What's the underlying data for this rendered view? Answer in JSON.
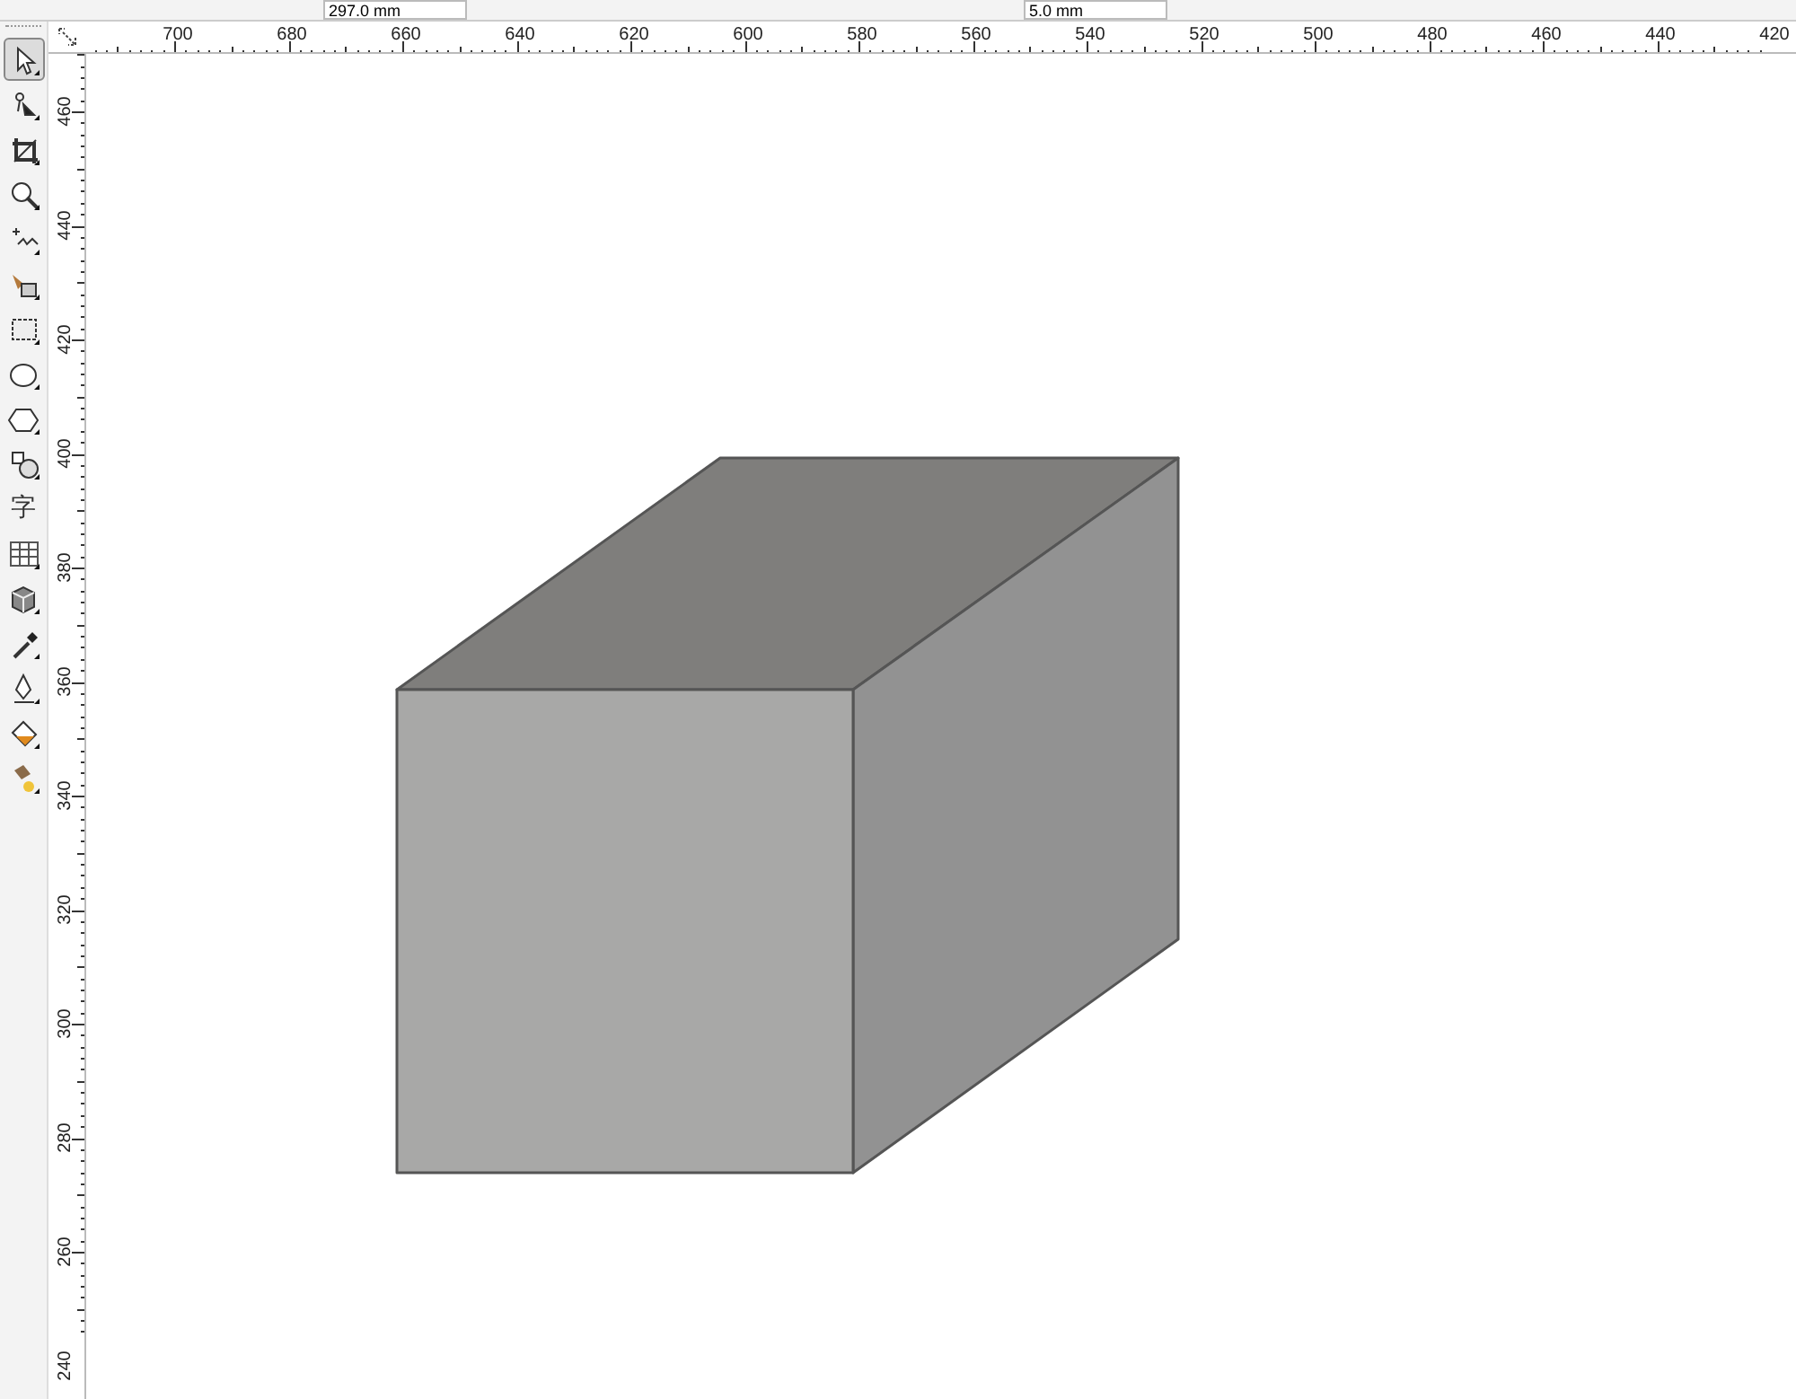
{
  "property_bar": {
    "fields": [
      {
        "value": "297.0 mm"
      },
      {
        "value": "5.0 mm"
      }
    ]
  },
  "toolbox": {
    "tools": [
      {
        "kind": "pick",
        "selected": true
      },
      {
        "kind": "shape",
        "selected": false
      },
      {
        "kind": "crop",
        "selected": false
      },
      {
        "kind": "zoom",
        "selected": false
      },
      {
        "kind": "freehand",
        "selected": false
      },
      {
        "kind": "smartfill",
        "selected": false
      },
      {
        "kind": "rectangle",
        "selected": false
      },
      {
        "kind": "ellipse",
        "selected": false
      },
      {
        "kind": "polygon",
        "selected": false
      },
      {
        "kind": "shapes",
        "selected": false
      },
      {
        "kind": "text",
        "label": "字",
        "selected": false
      },
      {
        "kind": "table",
        "selected": false
      },
      {
        "kind": "extrude",
        "selected": false
      },
      {
        "kind": "eyedropper",
        "selected": false
      },
      {
        "kind": "pen",
        "selected": false
      },
      {
        "kind": "fill",
        "selected": false
      },
      {
        "kind": "interactivefill",
        "selected": false
      }
    ]
  },
  "horizontal_ruler": {
    "labels": [
      "700",
      "680",
      "660",
      "640",
      "620",
      "600",
      "580",
      "560",
      "540",
      "520",
      "500",
      "480",
      "460",
      "440",
      "420"
    ]
  },
  "vertical_ruler": {
    "labels": [
      "460",
      "440",
      "420",
      "400",
      "380",
      "360",
      "340",
      "320",
      "300",
      "280",
      "260",
      "240"
    ]
  }
}
